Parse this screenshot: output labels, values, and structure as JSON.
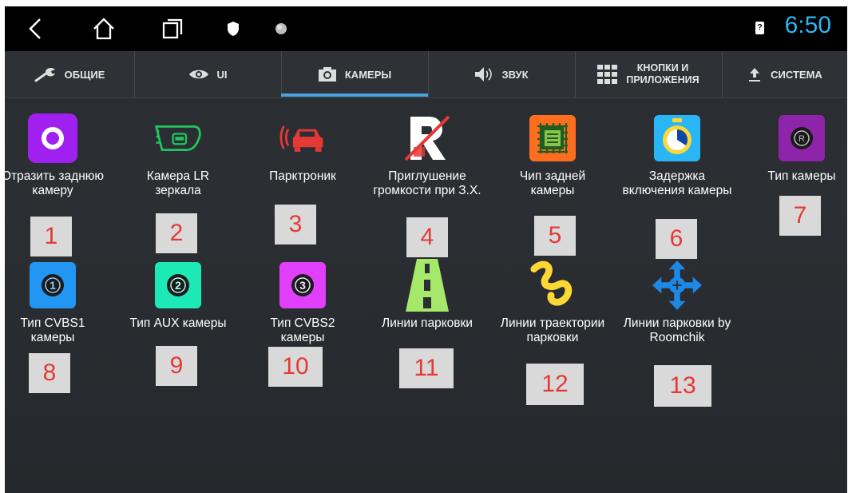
{
  "status": {
    "time": "6:50",
    "sim_label": "?"
  },
  "tabs": [
    {
      "label": "ОБЩИЕ",
      "icon": "wrench-icon"
    },
    {
      "label": "UI",
      "icon": "eye-icon"
    },
    {
      "label": "КАМЕРЫ",
      "icon": "camera-icon",
      "active": true
    },
    {
      "label": "ЗВУК",
      "icon": "speaker-icon"
    },
    {
      "label_line1": "КНОПКИ И",
      "label_line2": "ПРИЛОЖЕНИЯ",
      "icon": "grid-icon"
    },
    {
      "label": "СИСТЕМА",
      "icon": "upload-icon"
    }
  ],
  "items": [
    {
      "label": "Отразить заднюю камеру",
      "badge": "1",
      "icon": "mirror-ring-icon",
      "color": "#a020f0"
    },
    {
      "label": "Камера LR зеркала",
      "badge": "2",
      "icon": "mirror-car-icon",
      "color": "#22c55e"
    },
    {
      "label": "Парктроник",
      "badge": "3",
      "icon": "parktronic-car-icon",
      "color": "#e53935"
    },
    {
      "label": "Приглушение громкости при З.Х.",
      "badge": "4",
      "icon": "reverse-mute-icon",
      "color": "#e53935"
    },
    {
      "label": "Чип задней камеры",
      "badge": "5",
      "icon": "chip-icon",
      "color": "#ff6d1f"
    },
    {
      "label": "Задержка включения камеры",
      "badge": "6",
      "icon": "timer-icon",
      "color": "#29b6f6"
    },
    {
      "label": "Тип камеры",
      "badge": "7",
      "icon": "camera-type-r-icon",
      "color": "#8e24aa"
    },
    {
      "label": "Тип CVBS1 камеры",
      "badge": "8",
      "icon": "number-one-icon",
      "color": "#2196f3"
    },
    {
      "label": "Тип AUX камеры",
      "badge": "9",
      "icon": "number-two-icon",
      "color": "#1de9b6"
    },
    {
      "label": "Тип CVBS2 камеры",
      "badge": "10",
      "icon": "number-three-icon",
      "color": "#e040fb"
    },
    {
      "label": "Линии парковки",
      "badge": "11",
      "icon": "parking-lines-icon",
      "color": "#a5e86a"
    },
    {
      "label": "Линии траектории парковки",
      "badge": "12",
      "icon": "trajectory-icon",
      "color": "#fdd835"
    },
    {
      "label": "Линии парковки by Roomchik",
      "badge": "13",
      "icon": "move-arrows-icon",
      "color": "#1e88e5"
    }
  ]
}
